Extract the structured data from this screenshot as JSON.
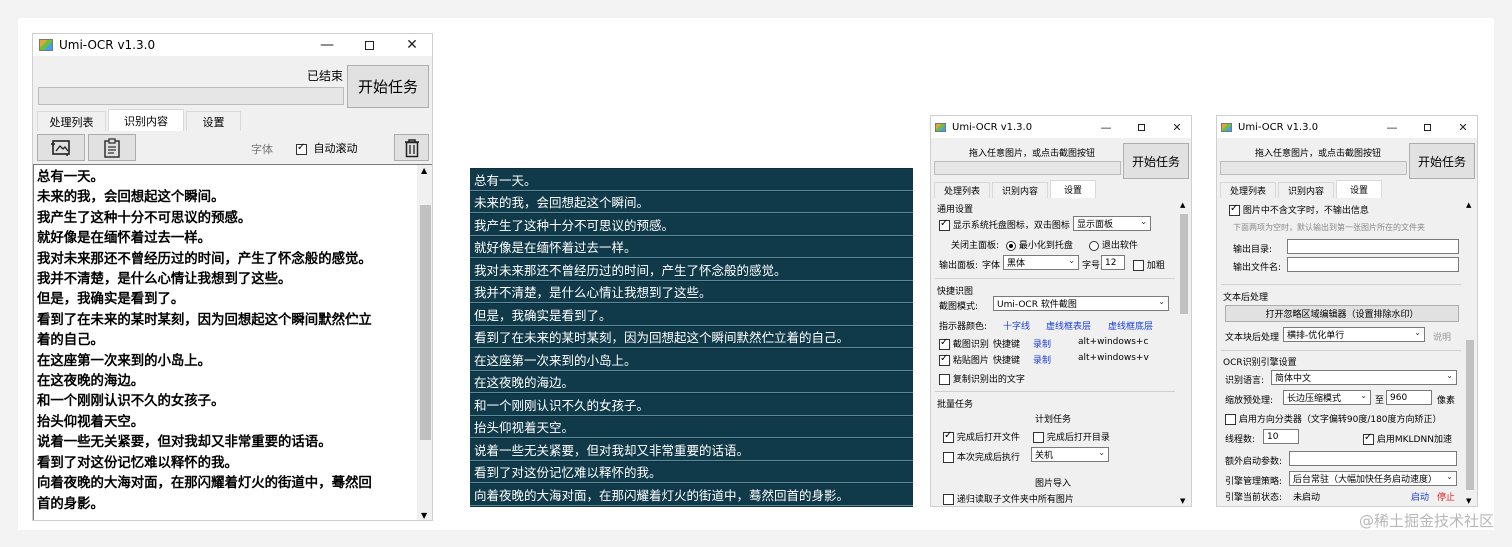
{
  "app": {
    "title": "Umi-OCR v1.3.0"
  },
  "window1": {
    "status": "已结束",
    "start_button": "开始任务",
    "tabs": [
      "处理列表",
      "识别内容",
      "设置"
    ],
    "active_tab": "识别内容",
    "font_label": "字体",
    "autoscroll_label": "自动滚动",
    "autoscroll_checked": true,
    "lines": [
      "总有一天。",
      "未来的我，会回想起这个瞬间。",
      "我产生了这种十分不可思议的预感。",
      "就好像是在缅怀着过去一样。",
      "我对未来那还不曾经历过的时间，产生了怀念般的感觉。",
      "我并不清楚，是什么心情让我想到了这些。",
      "但是，我确实是看到了。",
      "看到了在未来的某时某刻，因为回想起这个瞬间默然伫立",
      "着的自己。",
      "在这座第一次来到的小岛上。",
      "在这夜晚的海边。",
      "和一个刚刚认识不久的女孩子。",
      "抬头仰视着天空。",
      "说着一些无关紧要，但对我却又非常重要的话语。",
      "看到了对这份记忆难以释怀的我。",
      "向着夜晚的大海对面，在那闪耀着灯火的街道中，蓦然回",
      "首的身影。"
    ]
  },
  "dark_list": [
    "总有一天。",
    "未来的我，会回想起这个瞬间。",
    "我产生了这种十分不可思议的预感。",
    "就好像是在缅怀着过去一样。",
    "我对未来那还不曾经历过的时间，产生了怀念般的感觉。",
    "我并不清楚，是什么心情让我想到了这些。",
    "但是，我确实是看到了。",
    "看到了在未来的某时某刻，因为回想起这个瞬间默然伫立着的自己。",
    "在这座第一次来到的小岛上。",
    "在这夜晚的海边。",
    "和一个刚刚认识不久的女孩子。",
    "抬头仰视着天空。",
    "说着一些无关紧要，但对我却又非常重要的话语。",
    "看到了对这份记忆难以释怀的我。",
    "向着夜晚的大海对面，在那闪耀着灯火的街道中，蓦然回首的身影。"
  ],
  "window2": {
    "hint": "拖入任意图片，或点击截图按钮",
    "start_button": "开始任务",
    "tabs": [
      "处理列表",
      "识别内容",
      "设置"
    ],
    "active_tab": "设置",
    "general": {
      "title": "通用设置",
      "tray_label": "显示系统托盘图标，双击图标",
      "tray_checked": true,
      "tray_select": "显示面板",
      "close_label": "关闭主面板:",
      "close_opt1": "最小化到托盘",
      "close_opt2": "退出软件",
      "output_label": "输出面板:",
      "font_label": "字体",
      "font_value": "黑体",
      "size_label": "字号",
      "size_value": "12",
      "bold_label": "加粗"
    },
    "shortcut": {
      "title": "快捷识图",
      "mode_label": "截图模式:",
      "mode_value": "Umi-OCR 软件截图",
      "color_label": "指示器颜色:",
      "color_opts": [
        "十字线",
        "虚线框表层",
        "虚线框底层"
      ],
      "screenshot_label": "截图识别",
      "screenshot_checked": true,
      "paste_label": "粘贴图片",
      "paste_checked": true,
      "hotkey_label": "快捷键",
      "record_label": "录制",
      "hotkey1": "alt+windows+c",
      "hotkey2": "alt+windows+v",
      "copy_label": "复制识别出的文字",
      "copy_checked": false
    },
    "batch": {
      "title": "批量任务",
      "plan_title": "计划任务",
      "open_file_label": "完成后打开文件",
      "open_file_checked": true,
      "open_dir_label": "完成后打开目录",
      "open_dir_checked": false,
      "exec_label": "本次完成后执行",
      "exec_checked": false,
      "exec_value": "关机",
      "import_title": "图片导入",
      "recursive_label": "递归读取子文件夹中所有图片",
      "recursive_checked": false
    }
  },
  "window3": {
    "hint": "拖入任意图片，或点击截图按钮",
    "start_button": "开始任务",
    "tabs": [
      "处理列表",
      "识别内容",
      "设置"
    ],
    "active_tab": "设置",
    "no_text_label": "图片中不含文字时，不输出信息",
    "no_text_checked": true,
    "dir_hint": "下面两项为空时，默认输出到第一张图片所在的文件夹",
    "output_dir_label": "输出目录:",
    "output_name_label": "输出文件名:",
    "postprocess": {
      "title": "文本后处理",
      "editor_button": "打开忽略区域编辑器（设置排除水印）",
      "block_label": "文本块后处理",
      "block_value": "横排-优化单行",
      "explain": "说明"
    },
    "engine": {
      "title": "OCR识别引擎设置",
      "lang_label": "识别语言:",
      "lang_value": "简体中文",
      "scale_label": "缩放预处理:",
      "scale_value": "长边压缩模式",
      "to_label": "至",
      "scale_num": "960",
      "pixel_label": "像素",
      "angle_label": "启用方向分类器（文字偏转90度/180度方向矫正）",
      "angle_checked": false,
      "threads_label": "线程数:",
      "threads_value": "10",
      "mkldnn_label": "启用MKLDNN加速",
      "mkldnn_checked": true,
      "extra_label": "额外启动参数:",
      "policy_label": "引擎管理策略:",
      "policy_value": "后台常驻（大幅加快任务启动速度）",
      "state_label": "引擎当前状态:",
      "state_value": "未启动",
      "start_label": "启动",
      "stop_label": "停止"
    }
  },
  "watermark": "@稀土掘金技术社区",
  "colors": {
    "dark_bg": "#0d2e3a",
    "link": "#1a3fe0",
    "stop": "#e02020"
  }
}
